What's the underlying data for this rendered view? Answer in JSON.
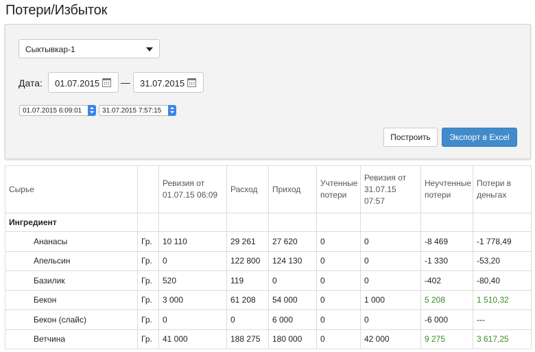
{
  "page": {
    "title": "Потери/Избыток"
  },
  "filters": {
    "store": "Сыктывкар-1",
    "date_label": "Дата:",
    "date_from": "01.07.2015",
    "date_separator": "—",
    "date_to": "31.07.2015",
    "revision_from": "01.07.2015 6:09:01",
    "revision_to": "31.07.2015 7:57:15",
    "build_label": "Построить",
    "export_label": "Экспорт в Excel"
  },
  "table": {
    "columns": [
      "Сырье",
      "",
      "Ревизия от 01.07.15 06:09",
      "Расход",
      "Приход",
      "Учтенные потери",
      "Ревизия от 31.07.15 07:57",
      "Неучтенные потери",
      "Потери в деньгах"
    ],
    "group_label": "Ингредиент",
    "rows": [
      {
        "name": "Ананасы",
        "unit": "Гр.",
        "rev_start": "10 110",
        "expense": "29 261",
        "income": "27 620",
        "accounted": "0",
        "rev_end": "0",
        "unaccounted": "-8 469",
        "money": "-1 778,49",
        "positive": false
      },
      {
        "name": "Апельсин",
        "unit": "Гр.",
        "rev_start": "0",
        "expense": "122 800",
        "income": "124 130",
        "accounted": "0",
        "rev_end": "0",
        "unaccounted": "-1 330",
        "money": "-53,20",
        "positive": false
      },
      {
        "name": "Базилик",
        "unit": "Гр.",
        "rev_start": "520",
        "expense": "119",
        "income": "0",
        "accounted": "0",
        "rev_end": "0",
        "unaccounted": "-402",
        "money": "-80,40",
        "positive": false
      },
      {
        "name": "Бекон",
        "unit": "Гр.",
        "rev_start": "3 000",
        "expense": "61 208",
        "income": "54 000",
        "accounted": "0",
        "rev_end": "1 000",
        "unaccounted": "5 208",
        "money": "1 510,32",
        "positive": true
      },
      {
        "name": "Бекон (слайс)",
        "unit": "Гр.",
        "rev_start": "0",
        "expense": "0",
        "income": "6 000",
        "accounted": "0",
        "rev_end": "0",
        "unaccounted": "-6 000",
        "money": "---",
        "positive": false
      },
      {
        "name": "Ветчина",
        "unit": "Гр.",
        "rev_start": "41 000",
        "expense": "188 275",
        "income": "180 000",
        "accounted": "0",
        "rev_end": "42 000",
        "unaccounted": "9 275",
        "money": "3 617,25",
        "positive": true
      }
    ]
  },
  "colors": {
    "accent": "#428bca",
    "positive_text": "#3a8a27",
    "panel_bg": "#f3f3f3"
  }
}
